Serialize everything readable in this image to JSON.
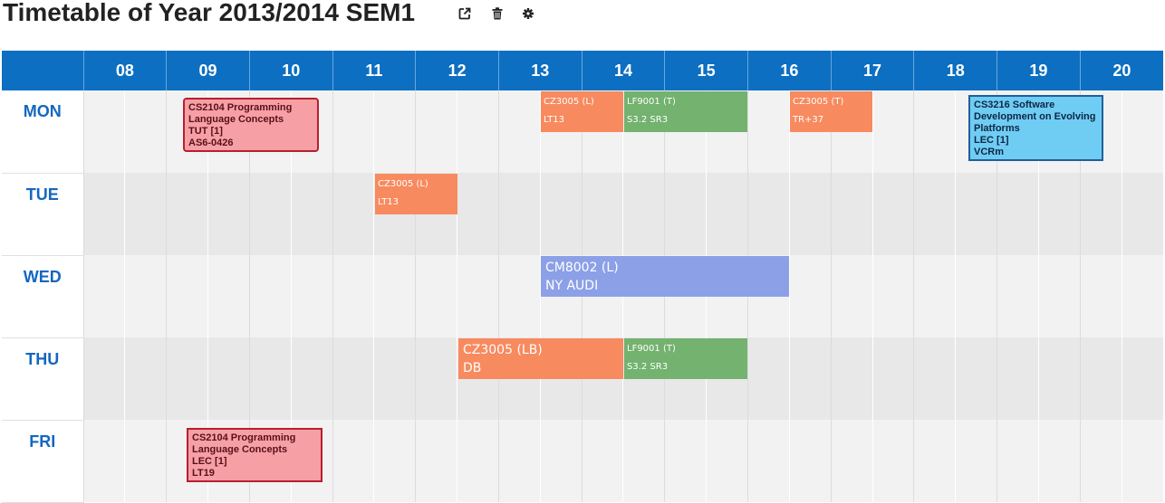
{
  "page": {
    "title": "Timetable of Year 2013/2014 SEM1"
  },
  "icons": {
    "share": "share-icon",
    "delete": "trash-icon",
    "settings": "gear-icon"
  },
  "hours": [
    "08",
    "09",
    "10",
    "11",
    "12",
    "13",
    "14",
    "15",
    "16",
    "17",
    "18",
    "19",
    "20"
  ],
  "days": [
    "MON",
    "TUE",
    "WED",
    "THU",
    "FRI"
  ],
  "colors": {
    "header": "#0c6fc2",
    "day_text": "#1467c0",
    "orange": "#f88a5f",
    "green": "#73b26f",
    "blue": "#8ca0e8",
    "pink": "#f6a0a6",
    "sky": "#6fcdf3"
  },
  "lessons": {
    "mon_cs2104": {
      "code": "CS2104 Programming",
      "line2": "Language Concepts",
      "type": "TUT [1]",
      "venue": "AS6-0426"
    },
    "mon_cz3005_l": {
      "code": "CZ3005 (L)",
      "venue": "LT13"
    },
    "mon_lf9001": {
      "code": "LF9001 (T)",
      "venue": "S3.2 SR3"
    },
    "mon_cz3005_t": {
      "code": "CZ3005 (T)",
      "venue": "TR+37"
    },
    "mon_cs3216": {
      "code": "CS3216 Software",
      "line2": "Development on Evolving",
      "line3": "Platforms",
      "type": "LEC [1]",
      "venue": "VCRm"
    },
    "tue_cz3005_l": {
      "code": "CZ3005 (L)",
      "venue": "LT13"
    },
    "wed_cm8002": {
      "code": "CM8002 (L)",
      "venue": "NY AUDI"
    },
    "thu_cz3005_lb": {
      "code": "CZ3005 (LB)",
      "venue": "DB"
    },
    "thu_lf9001": {
      "code": "LF9001 (T)",
      "venue": "S3.2 SR3"
    },
    "fri_cs2104": {
      "code": "CS2104 Programming",
      "line2": "Language Concepts",
      "type": "LEC [1]",
      "venue": "LT19"
    }
  }
}
